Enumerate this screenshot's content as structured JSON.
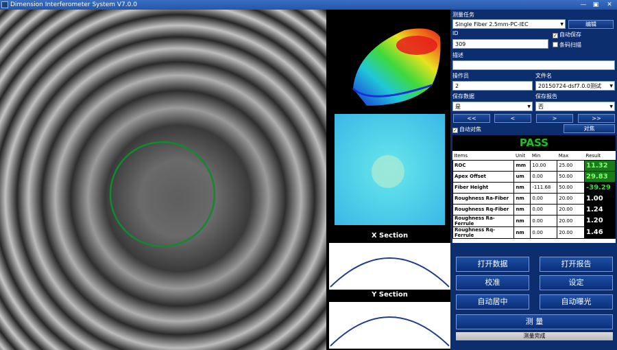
{
  "window": {
    "title": "Dimension Interferometer System V7.0.0",
    "minimize": "—",
    "restore": "▣",
    "close": "✕"
  },
  "sections": {
    "x_title": "X Section",
    "y_title": "Y Section"
  },
  "panel": {
    "task_label": "测量任务",
    "task_value": "Single Fiber 2.5mm-PC-IEC",
    "edit_button": "编辑",
    "id_label": "ID",
    "id_value": "309",
    "auto_save_label": "自动保存",
    "auto_save_checked": true,
    "barcode_scan_label": "条码扫描",
    "barcode_scan_checked": false,
    "desc_label": "描述",
    "desc_value": "",
    "operator_label": "操作员",
    "operator_value": "2",
    "filename_label": "文件名",
    "filename_value": "20150724-dsf7.0.0测试",
    "save_data_label": "保存数据",
    "save_data_value": "是",
    "save_report_label": "保存报告",
    "save_report_value": "否",
    "nav": {
      "first": "<<",
      "prev": "<",
      "next": ">",
      "last": ">>"
    },
    "auto_focus_label": "自动对焦",
    "auto_focus_checked": true,
    "focus_button": "对焦"
  },
  "results": {
    "status": "PASS",
    "status_color": "#18c31f",
    "columns": [
      "Items",
      "Unit",
      "Min",
      "Max",
      "Result"
    ],
    "rows": [
      {
        "item": "ROC",
        "unit": "mm",
        "min": "10.00",
        "max": "25.00",
        "result": "11.32",
        "bg": "#1a7a1a",
        "fg": "#7dff6b"
      },
      {
        "item": "Apex Offset",
        "unit": "um",
        "min": "0.00",
        "max": "50.00",
        "result": "29.83",
        "bg": "#1a7a1a",
        "fg": "#7dff6b"
      },
      {
        "item": "Fiber Height",
        "unit": "nm",
        "min": "-111.68",
        "max": "50.00",
        "result": "-39.29",
        "bg": "#000000",
        "fg": "#33dd33"
      },
      {
        "item": "Roughness Ra-Fiber",
        "unit": "nm",
        "min": "0.00",
        "max": "20.00",
        "result": "1.00",
        "bg": "#000000",
        "fg": "#ffffff"
      },
      {
        "item": "Roughness Rq-Fiber",
        "unit": "nm",
        "min": "0.00",
        "max": "20.00",
        "result": "1.24",
        "bg": "#000000",
        "fg": "#ffffff"
      },
      {
        "item": "Roughness Ra-Ferrule",
        "unit": "nm",
        "min": "0.00",
        "max": "20.00",
        "result": "1.20",
        "bg": "#000000",
        "fg": "#ffffff"
      },
      {
        "item": "Roughness Rq-Ferrule",
        "unit": "nm",
        "min": "0.00",
        "max": "20.00",
        "result": "1.46",
        "bg": "#000000",
        "fg": "#ffffff"
      }
    ]
  },
  "actions": {
    "open_data": "打开数据",
    "open_report": "打开报告",
    "calibrate": "校准",
    "settings": "设定",
    "auto_center": "自动居中",
    "auto_exposure": "自动曝光",
    "measure": "测 量"
  },
  "status_text": "测量完成",
  "colors": {
    "panel_bg": "#0c2d6e",
    "fringe_circle": "#0f8a2c",
    "section_curve": "#1f3d8a"
  }
}
